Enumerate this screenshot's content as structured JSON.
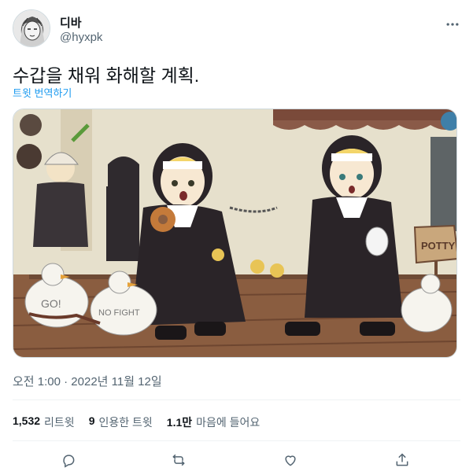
{
  "user": {
    "display_name": "디바",
    "handle": "@hyxpk"
  },
  "tweet": {
    "text": "수갑을 채워 화해할 계획.",
    "translate_label": "트윗 번역하기",
    "timestamp": "오전 1:00 · 2022년 11월 12일"
  },
  "stats": [
    {
      "count": "1,532",
      "label": "리트윗"
    },
    {
      "count": "9",
      "label": "인용한 트윗"
    },
    {
      "count": "1.1만",
      "label": "마음에 들어요"
    }
  ],
  "media": {
    "sign_text": "POTTY",
    "duck_left_text": "GO!",
    "duck_right_text": "NO FIGHT"
  },
  "icons": {
    "more": "more-horizontal-icon",
    "reply": "reply-icon",
    "retweet": "retweet-icon",
    "like": "heart-icon",
    "share": "share-icon"
  },
  "colors": {
    "link": "#1d9bf0",
    "secondary_text": "#536471",
    "primary_text": "#0f1419"
  }
}
